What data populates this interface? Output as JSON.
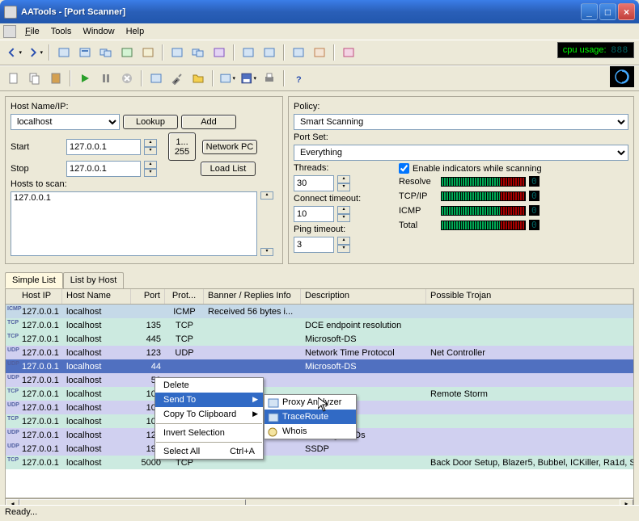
{
  "app": {
    "title": "AATools - [Port Scanner]",
    "status": "Ready..."
  },
  "menu": {
    "file": "File",
    "tools": "Tools",
    "window": "Window",
    "help": "Help"
  },
  "cpu": {
    "label": "cpu usage:",
    "value": "888"
  },
  "inputs": {
    "hostname_label": "Host Name/IP:",
    "hostname": "localhost",
    "start_label": "Start",
    "start": "127.0.0.1",
    "stop_label": "Stop",
    "stop": "127.0.0.1",
    "range": "1... 255",
    "lookup": "Lookup",
    "add": "Add",
    "networkpc": "Network PC",
    "loadlist": "Load List",
    "hoststoscan_label": "Hosts to scan:",
    "hoststoscan": "127.0.0.1"
  },
  "policy": {
    "policy_label": "Policy:",
    "policy": "Smart Scanning",
    "portset_label": "Port Set:",
    "portset": "Everything",
    "threads_label": "Threads:",
    "threads": "30",
    "connect_label": "Connect timeout:",
    "connect": "10",
    "ping_label": "Ping timeout:",
    "ping": "3",
    "indicators_label": "Enable indicators while scanning",
    "ind_resolve": "Resolve",
    "ind_tcpip": "TCP/IP",
    "ind_icmp": "ICMP",
    "ind_total": "Total"
  },
  "tabs": {
    "simple": "Simple List",
    "byhost": "List by Host"
  },
  "columns": {
    "hostip": "Host IP",
    "hostname": "Host Name",
    "port": "Port",
    "proto": "Prot...",
    "banner": "Banner / Replies Info",
    "desc": "Description",
    "trojan": "Possible Trojan"
  },
  "rows": [
    {
      "tag": "ICMP",
      "cls": "icmp",
      "ip": "127.0.0.1",
      "host": "localhost",
      "port": "",
      "proto": "ICMP",
      "banner": "Received 56 bytes i...",
      "desc": "",
      "trojan": ""
    },
    {
      "tag": "TCP",
      "cls": "tcp",
      "ip": "127.0.0.1",
      "host": "localhost",
      "port": "135",
      "proto": "TCP",
      "banner": "",
      "desc": "DCE endpoint resolution",
      "trojan": ""
    },
    {
      "tag": "TCP",
      "cls": "tcp",
      "ip": "127.0.0.1",
      "host": "localhost",
      "port": "445",
      "proto": "TCP",
      "banner": "",
      "desc": "Microsoft-DS",
      "trojan": ""
    },
    {
      "tag": "UDP",
      "cls": "udp",
      "ip": "127.0.0.1",
      "host": "localhost",
      "port": "123",
      "proto": "UDP",
      "banner": "",
      "desc": "Network Time Protocol",
      "trojan": "Net Controller"
    },
    {
      "tag": "UDP",
      "cls": "sel",
      "ip": "127.0.0.1",
      "host": "localhost",
      "port": "44",
      "proto": "",
      "banner": "",
      "desc": "Microsoft-DS",
      "trojan": ""
    },
    {
      "tag": "UDP",
      "cls": "udp",
      "ip": "127.0.0.1",
      "host": "localhost",
      "port": "50",
      "proto": "",
      "banner": "",
      "desc": "",
      "trojan": ""
    },
    {
      "tag": "TCP",
      "cls": "tcp",
      "ip": "127.0.0.1",
      "host": "localhost",
      "port": "102",
      "proto": "",
      "banner": "",
      "desc": "",
      "trojan": "Remote Storm"
    },
    {
      "tag": "UDP",
      "cls": "udp",
      "ip": "127.0.0.1",
      "host": "localhost",
      "port": "104",
      "proto": "",
      "banner": "",
      "desc": "",
      "trojan": ""
    },
    {
      "tag": "TCP",
      "cls": "tcp",
      "ip": "127.0.0.1",
      "host": "localhost",
      "port": "103",
      "proto": "",
      "banner": "",
      "desc": "",
      "trojan": ""
    },
    {
      "tag": "UDP",
      "cls": "udp",
      "ip": "127.0.0.1",
      "host": "localhost",
      "port": "121",
      "proto": "",
      "banner": "",
      "desc": "AeroFlight-ADs",
      "trojan": ""
    },
    {
      "tag": "UDP",
      "cls": "udp",
      "ip": "127.0.0.1",
      "host": "localhost",
      "port": "190",
      "proto": "",
      "banner": "",
      "desc": "SSDP",
      "trojan": ""
    },
    {
      "tag": "TCP",
      "cls": "tcp",
      "ip": "127.0.0.1",
      "host": "localhost",
      "port": "5000",
      "proto": "TCP",
      "banner": "",
      "desc": "",
      "trojan": "Back Door Setup, Blazer5, Bubbel, ICKiller, Ra1d, S"
    }
  ],
  "ctx": {
    "delete": "Delete",
    "sendto": "Send To",
    "copy": "Copy To Clipboard",
    "invert": "Invert Selection",
    "selectall": "Select All",
    "selectall_key": "Ctrl+A",
    "proxy": "Proxy Analyzer",
    "trace": "TraceRoute",
    "whois": "Whois"
  }
}
